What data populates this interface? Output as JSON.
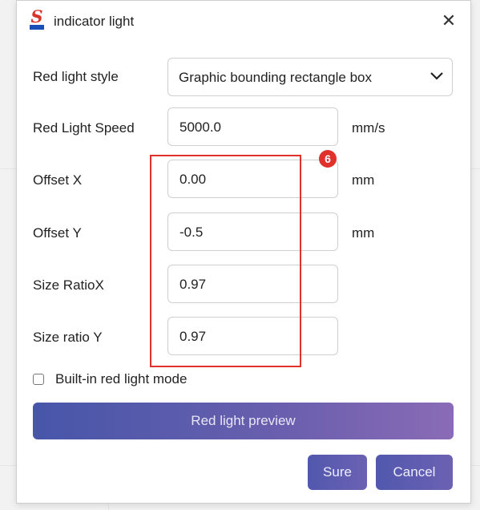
{
  "window": {
    "title": "indicator light",
    "close_glyph": "✕"
  },
  "form": {
    "style": {
      "label": "Red light style",
      "value": "Graphic bounding rectangle box"
    },
    "speed": {
      "label": "Red Light Speed",
      "value": "5000.0",
      "unit": "mm/s"
    },
    "offset_x": {
      "label": "Offset X",
      "value": "0.00",
      "unit": "mm"
    },
    "offset_y": {
      "label": "Offset Y",
      "value": "-0.5",
      "unit": "mm"
    },
    "size_x": {
      "label": "Size RatioX",
      "value": "0.97"
    },
    "size_y": {
      "label": "Size ratio Y",
      "value": "0.97"
    }
  },
  "annotation": {
    "badge": "6",
    "color": "#e0322b"
  },
  "builtin_mode": {
    "label": "Built-in red light mode",
    "checked": false
  },
  "buttons": {
    "preview": "Red light preview",
    "sure": "Sure",
    "cancel": "Cancel"
  },
  "colors": {
    "accent_start": "#4756a9",
    "accent_end": "#8a6bb6",
    "highlight": "#e0322b"
  }
}
